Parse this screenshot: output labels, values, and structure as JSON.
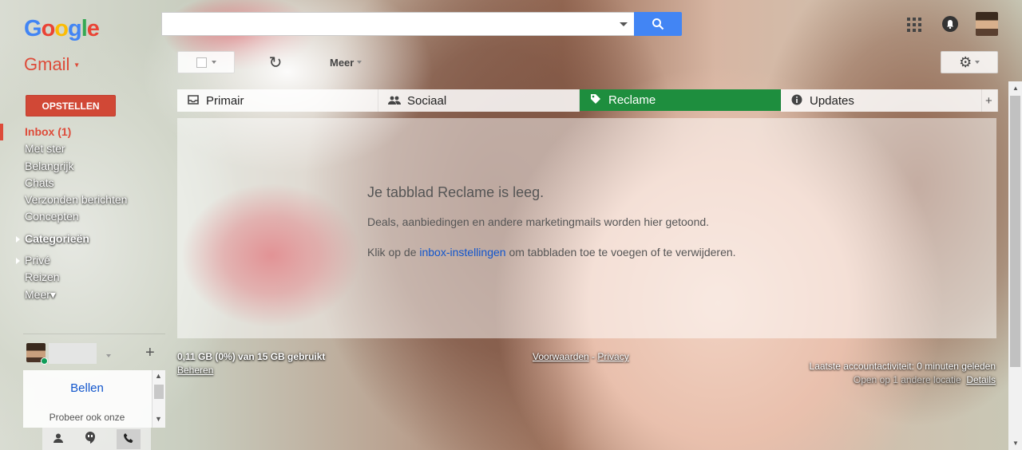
{
  "logo": {
    "g1": "G",
    "o1": "o",
    "o2": "o",
    "g2": "g",
    "l": "l",
    "e": "e"
  },
  "app_switcher": {
    "label": "Gmail",
    "caret": "▾"
  },
  "search": {
    "value": "",
    "placeholder": ""
  },
  "toolbar": {
    "more_label": "Meer",
    "more_caret": "▾",
    "refresh_glyph": "↻",
    "settings_glyph": "⚙"
  },
  "compose_label": "OPSTELLEN",
  "nav": {
    "items": [
      {
        "label": "Inbox (1)"
      },
      {
        "label": "Met ster"
      },
      {
        "label": "Belangrijk"
      },
      {
        "label": "Chats"
      },
      {
        "label": "Verzonden berichten"
      },
      {
        "label": "Concepten"
      },
      {
        "label": "Categorieën"
      },
      {
        "label": "Privé"
      },
      {
        "label": "Reizen"
      },
      {
        "label": "Meer▾"
      }
    ]
  },
  "tabs": [
    {
      "label": "Primair",
      "icon": "inbox-icon"
    },
    {
      "label": "Sociaal",
      "icon": "people-icon"
    },
    {
      "label": "Reclame",
      "icon": "tag-icon"
    },
    {
      "label": "Updates",
      "icon": "info-icon"
    }
  ],
  "tab_add": "+",
  "empty": {
    "title": "Je tabblad Reclame is leeg.",
    "description": "Deals, aanbiedingen en andere marketingmails worden hier getoond.",
    "hint_before": "Klik op de ",
    "hint_link": "inbox-instellingen",
    "hint_after": " om tabbladen toe te voegen of te verwijderen."
  },
  "footer": {
    "storage": "0,11 GB (0%) van 15 GB gebruikt",
    "manage": "Beheren",
    "terms": "Voorwaarden",
    "sep": " - ",
    "privacy": "Privacy",
    "activity": "Laatste accountactiviteit: 0 minuten geleden",
    "other_location": "Open op 1 andere locatie",
    "details": "Details"
  },
  "hangouts": {
    "call_label": "Bellen",
    "try_text": "Probeer ook onze",
    "plus": "+"
  },
  "colors": {
    "accent": "#dd4b39",
    "tab_selected": "#1e8e3e",
    "search_button": "#4285f4",
    "link": "#1155cc"
  }
}
